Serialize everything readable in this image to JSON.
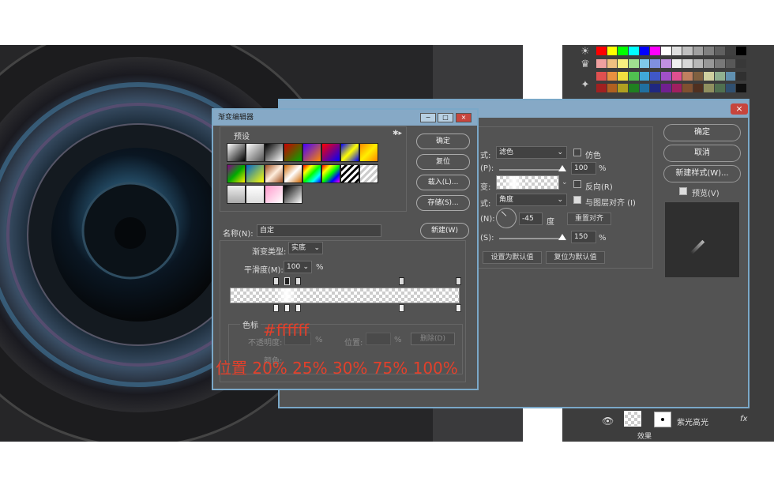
{
  "canvas": {
    "description_color": "#2a2a2c"
  },
  "swatch_colors": [
    "#ff0000",
    "#ffff00",
    "#00ff00",
    "#00ffff",
    "#0000ff",
    "#ff00ff",
    "#ffffff",
    "#e0e0e0",
    "#c0c0c0",
    "#a0a0a0",
    "#808080",
    "#606060",
    "#404040",
    "#000000",
    "#f0a0a0",
    "#f0c080",
    "#f8f080",
    "#a0e090",
    "#80c8e8",
    "#8090e0",
    "#c090e0",
    "#f0f0f0",
    "#d8d8d8",
    "#b8b8b8",
    "#989898",
    "#787878",
    "#585858",
    "#383838",
    "#e05050",
    "#e89040",
    "#f0e040",
    "#50c050",
    "#40a8d8",
    "#4058c8",
    "#a050c8",
    "#e05090",
    "#c08060",
    "#806040",
    "#d0d0a0",
    "#90b090",
    "#6090b0",
    "#303030",
    "#a02020",
    "#b06020",
    "#b0a020",
    "#208020",
    "#2070a0",
    "#202880",
    "#702090",
    "#a02060",
    "#805030",
    "#503020",
    "#909060",
    "#507050",
    "#305070",
    "#101010"
  ],
  "layer_style": {
    "ok": "确定",
    "cancel": "取消",
    "new_style": "新建样式(W)...",
    "preview": "预览(V)",
    "blend_mode_label": "式:",
    "blend_mode_value": "滤色",
    "dither": "仿色",
    "opacity_label": "(P):",
    "opacity_value": "100",
    "pct": "%",
    "gradient_label": "变:",
    "reverse": "反向(R)",
    "style_label": "式:",
    "style_value": "角度",
    "align": "与图层对齐 (I)",
    "angle_label": "(N):",
    "angle_value": "-45",
    "degree": "度",
    "reset_align": "重置对齐",
    "scale_label": "(S):",
    "scale_value": "150",
    "set_default": "设置为默认值",
    "reset_default": "复位为默认值"
  },
  "gradient_editor": {
    "title": "渐变编辑器",
    "presets_label": "预设",
    "ok": "确定",
    "reset": "复位",
    "load": "载入(L)...",
    "save": "存储(S)...",
    "name_label": "名称(N):",
    "name_value": "自定",
    "new": "新建(W)",
    "type_label": "渐变类型:",
    "type_value": "实底",
    "smooth_label": "平滑度(M):",
    "smooth_value": "100",
    "pct": "%",
    "stops_label": "色标",
    "opacity_label": "不透明度:",
    "location_label": "位置:",
    "delete": "删除(D)",
    "color_label": "颜色:"
  },
  "annotations": {
    "color_hex": "#ffffff",
    "positions": "位置 20% 25% 30% 75% 100%"
  },
  "layers": {
    "layer_name": "紫光高光",
    "fx": "fx",
    "effects": "效果"
  }
}
